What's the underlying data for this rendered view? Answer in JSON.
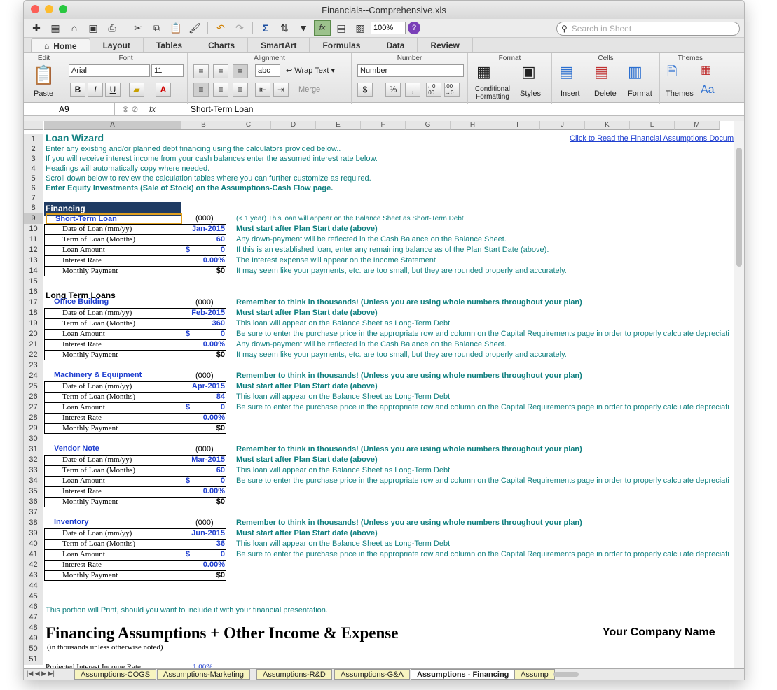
{
  "window": {
    "title": "Financials--Comprehensive.xls"
  },
  "toolbar": {
    "zoom": "100%",
    "search_placeholder": "Search in Sheet"
  },
  "ribbon_tabs": [
    "Home",
    "Layout",
    "Tables",
    "Charts",
    "SmartArt",
    "Formulas",
    "Data",
    "Review"
  ],
  "groups": {
    "edit": "Edit",
    "font": "Font",
    "alignment": "Alignment",
    "number": "Number",
    "format": "Format",
    "cells": "Cells",
    "themes": "Themes"
  },
  "controls": {
    "paste": "Paste",
    "font_name": "Arial",
    "font_size": "11",
    "wrap_text": "Wrap Text",
    "merge": "Merge",
    "abc": "abc",
    "number_format": "Number",
    "percent": "%",
    "comma": ",",
    "dec_inc": "←0 .00",
    "dec_dec": ".00 →0",
    "conditional_formatting": "Conditional Formatting",
    "styles": "Styles",
    "insert": "Insert",
    "delete": "Delete",
    "format": "Format",
    "themes": "Themes",
    "aa": "Aa"
  },
  "formula_bar": {
    "cell_ref": "A9",
    "fx": "fx",
    "content": "Short-Term Loan"
  },
  "columns": [
    "A",
    "B",
    "C",
    "D",
    "E",
    "F",
    "G",
    "H",
    "I",
    "J",
    "K",
    "L",
    "M"
  ],
  "link": "Click to Read the Financial Assumptions Docum",
  "intro": {
    "title": "Loan Wizard",
    "lines": [
      "Enter any existing and/or planned debt financing using the calculators provided below..",
      "If you will receive interest income from your cash balances enter the assumed interest rate below.",
      "Headings will automatically copy where needed.",
      "Scroll down below to review the calculation tables where you can further customize as required.",
      "Enter Equity Investments (Sale of Stock) on the Assumptions-Cash Flow page."
    ]
  },
  "financing_header": "Financing",
  "long_term_header": "Long Term Loans",
  "field_labels": [
    "Date of Loan (mm/yy)",
    "Term of Loan (Months)",
    "Loan Amount",
    "Interest Rate",
    "Monthly Payment"
  ],
  "units": "(000)",
  "dollar": "$",
  "loans": [
    {
      "name": "Short-Term Loan",
      "date": "Jan-2015",
      "term": "60",
      "amount": "0",
      "rate": "0.00%",
      "payment": "$0",
      "notes": [
        "(< 1 year) This loan will appear on the Balance Sheet as Short-Term Debt",
        "Must start after Plan Start date (above)",
        "Any down-payment will be reflected in the Cash Balance on the Balance Sheet.",
        "If this is an established loan, enter any remaining balance as of the Plan Start Date (above).",
        "The Interest expense will appear on the Income Statement",
        "It may seem like your payments, etc. are too small, but they are rounded properly and accurately."
      ]
    },
    {
      "name": "Office Building",
      "date": "Feb-2015",
      "term": "360",
      "amount": "0",
      "rate": "0.00%",
      "payment": "$0",
      "notes": [
        "Remember to think in thousands! (Unless you are using whole numbers throughout your plan)",
        "Must start after Plan Start date (above)",
        "This loan will appear on the Balance Sheet as Long-Term Debt",
        "Be sure to enter the purchase price in the appropriate row and column on the Capital Requirements page in order to properly calculate depreciati",
        "Any down-payment will be reflected in the Cash Balance on the Balance Sheet.",
        "It may seem like your payments, etc. are too small, but they are rounded properly and accurately."
      ]
    },
    {
      "name": "Machinery & Equipment",
      "date": "Apr-2015",
      "term": "84",
      "amount": "0",
      "rate": "0.00%",
      "payment": "$0",
      "notes": [
        "Remember to think in thousands! (Unless you are using whole numbers throughout your plan)",
        "Must start after Plan Start date (above)",
        "This loan will appear on the Balance Sheet as Long-Term Debt",
        "Be sure to enter the purchase price in the appropriate row and column on the Capital Requirements page in order to properly calculate depreciati"
      ]
    },
    {
      "name": "Vendor Note",
      "date": "Mar-2015",
      "term": "60",
      "amount": "0",
      "rate": "0.00%",
      "payment": "$0",
      "notes": [
        "Remember to think in thousands! (Unless you are using whole numbers throughout your plan)",
        "Must start after Plan Start date (above)",
        "This loan will appear on the Balance Sheet as Long-Term Debt",
        "Be sure to enter the purchase price in the appropriate row and column on the Capital Requirements page in order to properly calculate depreciati"
      ]
    },
    {
      "name": "Inventory",
      "date": "Jun-2015",
      "term": "36",
      "amount": "0",
      "rate": "0.00%",
      "payment": "$0",
      "notes": [
        "Remember to think in thousands! (Unless you are using whole numbers throughout your plan)",
        "Must start after Plan Start date (above)",
        "This loan will appear on the Balance Sheet as Long-Term Debt",
        "Be sure to enter the purchase price in the appropriate row and column on the Capital Requirements page in order to properly calculate depreciati"
      ]
    }
  ],
  "print_note": "This portion will Print, should you want to include it with your financial presentation.",
  "print_title": "Financing Assumptions + Other Income & Expense",
  "company": "Your Company Name",
  "print_subtitle": "(in thousands unless otherwise noted)",
  "interest_income_label": "Projected Interest Income Rate:",
  "interest_income_value": "1.00%",
  "sheet_tabs": [
    "Assumptions-COGS",
    "Assumptions-Marketing",
    "Assumptions-R&D",
    "Assumptions-G&A",
    "Assumptions - Financing",
    "Assump"
  ],
  "colors": {
    "teal": "#0f7f7f",
    "blue": "#1f3fd0",
    "header_fill": "#1f3b63",
    "sheet_tab": "#f7f4c0"
  }
}
